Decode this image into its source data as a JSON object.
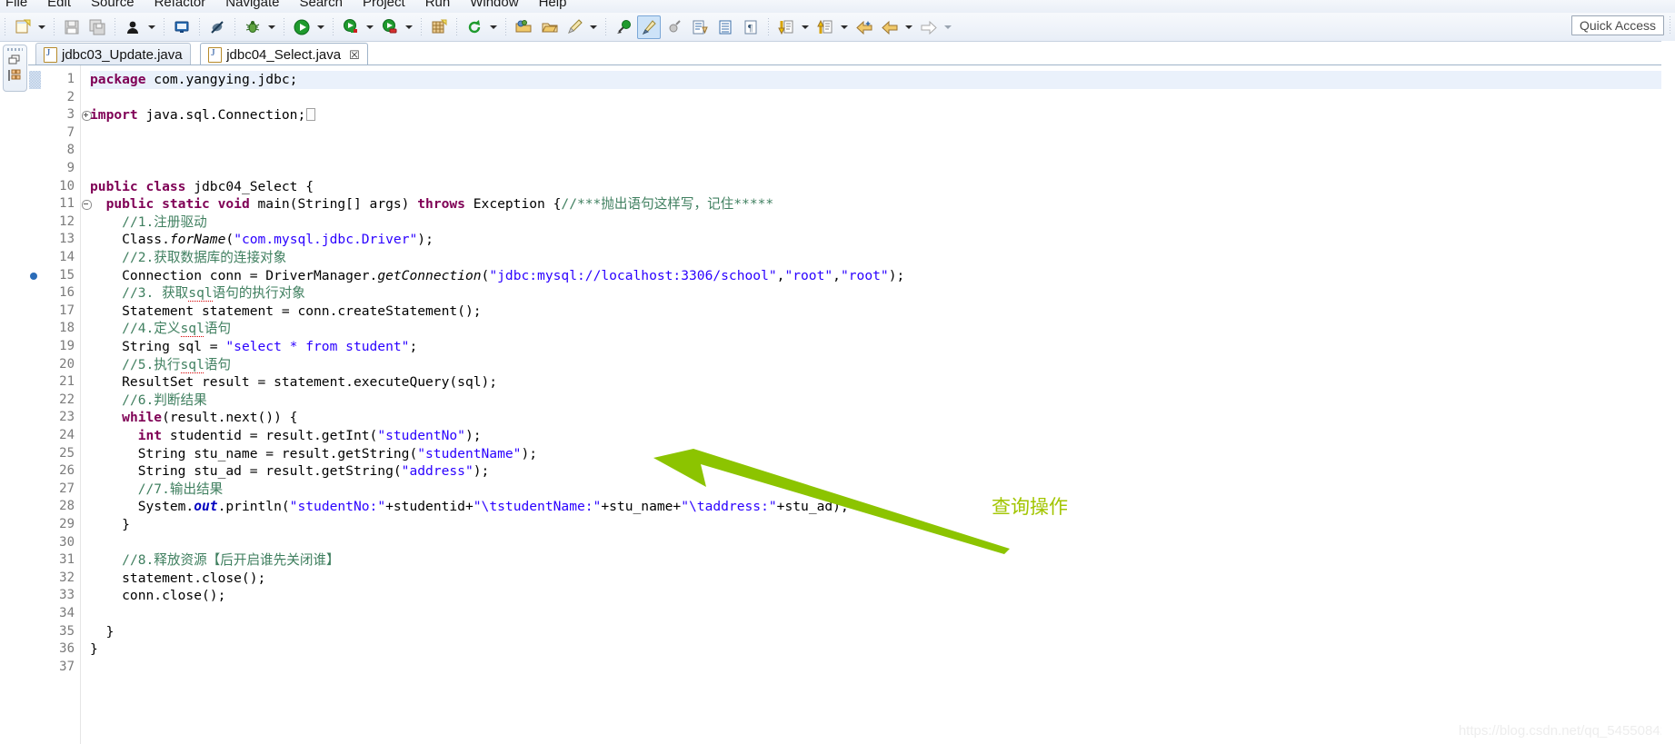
{
  "menubar": {
    "items": [
      "File",
      "Edit",
      "Source",
      "Refactor",
      "Navigate",
      "Search",
      "Project",
      "Run",
      "Window",
      "Help"
    ]
  },
  "toolbar": {
    "quick_access_label": "Quick Access",
    "buttons": [
      {
        "name": "new-wizard",
        "icon": "new-file-icon"
      },
      {
        "name": "save",
        "icon": "save-icon"
      },
      {
        "name": "save-all",
        "icon": "save-all-icon"
      },
      {
        "name": "person",
        "icon": "person-icon"
      },
      {
        "name": "console",
        "icon": "console-icon"
      },
      {
        "name": "skip-breakpoints",
        "icon": "skip-breakpoints-icon"
      },
      {
        "name": "debug",
        "icon": "bug-icon"
      },
      {
        "name": "run",
        "icon": "run-icon"
      },
      {
        "name": "run-as-coverage",
        "icon": "coverage-icon"
      },
      {
        "name": "profile",
        "icon": "profile-icon"
      },
      {
        "name": "new-package",
        "icon": "new-package-icon"
      },
      {
        "name": "refresh",
        "icon": "refresh-icon"
      },
      {
        "name": "open-type",
        "icon": "open-folder-icon"
      },
      {
        "name": "open-resource",
        "icon": "open-resource-icon"
      },
      {
        "name": "edit-pencil",
        "icon": "pencil-icon"
      },
      {
        "name": "search",
        "icon": "search-icon"
      },
      {
        "name": "marker-brush",
        "icon": "brush-icon"
      },
      {
        "name": "toggle-mark",
        "icon": "mark-occurrence-icon"
      },
      {
        "name": "next-annotation",
        "icon": "next-annotation-icon"
      },
      {
        "name": "outline",
        "icon": "outline-icon"
      },
      {
        "name": "paragraph",
        "icon": "pilcrow-icon"
      },
      {
        "name": "next-edit",
        "icon": "next-edit-icon"
      },
      {
        "name": "previous-edit",
        "icon": "previous-edit-icon"
      },
      {
        "name": "back",
        "icon": "back-arrow-icon"
      },
      {
        "name": "forward",
        "icon": "forward-arrow-icon"
      },
      {
        "name": "forward-gray",
        "icon": "forward-gray-arrow-icon"
      }
    ]
  },
  "viewstack": {
    "restore_icon": "restore-icon",
    "items": [
      {
        "name": "package-explorer",
        "icon": "package-explorer-icon"
      }
    ]
  },
  "tabs": [
    {
      "label": "jdbc03_Update.java",
      "active": false,
      "closable": false
    },
    {
      "label": "jdbc04_Select.java",
      "active": true,
      "closable": true,
      "close_glyph": "☒"
    }
  ],
  "editor": {
    "filename": "jdbc04_Select.java",
    "highlighted_line": 1,
    "breakpoint_line": 15,
    "folded_line": 3,
    "collapsible_line": 11,
    "line_numbers": [
      1,
      2,
      3,
      7,
      8,
      9,
      10,
      11,
      12,
      13,
      14,
      15,
      16,
      17,
      18,
      19,
      20,
      21,
      22,
      23,
      24,
      25,
      26,
      27,
      28,
      29,
      30,
      31,
      32,
      33,
      34,
      35,
      36,
      37
    ],
    "lines": [
      {
        "n": 1,
        "segments": [
          {
            "t": "package",
            "c": "kw"
          },
          {
            "t": " com.yangying.jdbc;",
            "c": ""
          }
        ]
      },
      {
        "n": 2,
        "segments": []
      },
      {
        "n": 3,
        "segments": [
          {
            "t": "import",
            "c": "kw"
          },
          {
            "t": " java.sql.Connection;",
            "c": ""
          },
          {
            "t": "□",
            "c": "foldbox"
          }
        ]
      },
      {
        "n": 7,
        "segments": []
      },
      {
        "n": 8,
        "segments": []
      },
      {
        "n": 9,
        "segments": []
      },
      {
        "n": 10,
        "segments": [
          {
            "t": "public class",
            "c": "kw"
          },
          {
            "t": " jdbc04_Select {",
            "c": ""
          }
        ]
      },
      {
        "n": 11,
        "segments": [
          {
            "t": "  ",
            "c": ""
          },
          {
            "t": "public static void",
            "c": "kw"
          },
          {
            "t": " main(String[] args) ",
            "c": ""
          },
          {
            "t": "throws",
            "c": "kw"
          },
          {
            "t": " Exception {",
            "c": ""
          },
          {
            "t": "//***抛出语句这样写，记住*****",
            "c": "cmt"
          }
        ]
      },
      {
        "n": 12,
        "segments": [
          {
            "t": "    ",
            "c": ""
          },
          {
            "t": "//1.注册驱动",
            "c": "cmt"
          }
        ]
      },
      {
        "n": 13,
        "segments": [
          {
            "t": "    Class.",
            "c": ""
          },
          {
            "t": "forName",
            "c": "smeth"
          },
          {
            "t": "(",
            "c": ""
          },
          {
            "t": "\"com.mysql.jdbc.Driver\"",
            "c": "str"
          },
          {
            "t": ");",
            "c": ""
          }
        ]
      },
      {
        "n": 14,
        "segments": [
          {
            "t": "    ",
            "c": ""
          },
          {
            "t": "//2.获取数据库的连接对象",
            "c": "cmt"
          }
        ]
      },
      {
        "n": 15,
        "segments": [
          {
            "t": "    Connection conn = DriverManager.",
            "c": ""
          },
          {
            "t": "getConnection",
            "c": "smeth"
          },
          {
            "t": "(",
            "c": ""
          },
          {
            "t": "\"jdbc:mysql://localhost:3306/school\"",
            "c": "str"
          },
          {
            "t": ",",
            "c": ""
          },
          {
            "t": "\"root\"",
            "c": "str"
          },
          {
            "t": ",",
            "c": ""
          },
          {
            "t": "\"root\"",
            "c": "str"
          },
          {
            "t": ");",
            "c": ""
          }
        ]
      },
      {
        "n": 16,
        "segments": [
          {
            "t": "    ",
            "c": ""
          },
          {
            "t": "//3. 获取",
            "c": "cmt"
          },
          {
            "t": "sql",
            "c": "cmt-spell"
          },
          {
            "t": "语句的执行对象",
            "c": "cmt"
          }
        ]
      },
      {
        "n": 17,
        "segments": [
          {
            "t": "    Statement statement = conn.createStatement();",
            "c": ""
          }
        ]
      },
      {
        "n": 18,
        "segments": [
          {
            "t": "    ",
            "c": ""
          },
          {
            "t": "//4.定义",
            "c": "cmt"
          },
          {
            "t": "sql",
            "c": "cmt-spell"
          },
          {
            "t": "语句",
            "c": "cmt"
          }
        ]
      },
      {
        "n": 19,
        "segments": [
          {
            "t": "    String sql = ",
            "c": ""
          },
          {
            "t": "\"select * from student\"",
            "c": "str"
          },
          {
            "t": ";",
            "c": ""
          }
        ]
      },
      {
        "n": 20,
        "segments": [
          {
            "t": "    ",
            "c": ""
          },
          {
            "t": "//5.执行",
            "c": "cmt"
          },
          {
            "t": "sql",
            "c": "cmt-spell"
          },
          {
            "t": "语句",
            "c": "cmt"
          }
        ]
      },
      {
        "n": 21,
        "segments": [
          {
            "t": "    ResultSet result = statement.executeQuery(sql);",
            "c": ""
          }
        ]
      },
      {
        "n": 22,
        "segments": [
          {
            "t": "    ",
            "c": ""
          },
          {
            "t": "//6.判断结果",
            "c": "cmt"
          }
        ]
      },
      {
        "n": 23,
        "segments": [
          {
            "t": "    ",
            "c": ""
          },
          {
            "t": "while",
            "c": "kw"
          },
          {
            "t": "(result.next()) {",
            "c": ""
          }
        ]
      },
      {
        "n": 24,
        "segments": [
          {
            "t": "      ",
            "c": ""
          },
          {
            "t": "int",
            "c": "kw"
          },
          {
            "t": " studentid = result.getInt(",
            "c": ""
          },
          {
            "t": "\"studentNo\"",
            "c": "str"
          },
          {
            "t": ");",
            "c": ""
          }
        ]
      },
      {
        "n": 25,
        "segments": [
          {
            "t": "      String stu_name = result.getString(",
            "c": ""
          },
          {
            "t": "\"studentName\"",
            "c": "str"
          },
          {
            "t": ");",
            "c": ""
          }
        ]
      },
      {
        "n": 26,
        "segments": [
          {
            "t": "      String stu_ad = result.getString(",
            "c": ""
          },
          {
            "t": "\"address\"",
            "c": "str"
          },
          {
            "t": ");",
            "c": ""
          }
        ]
      },
      {
        "n": 27,
        "segments": [
          {
            "t": "      ",
            "c": ""
          },
          {
            "t": "//7.输出结果",
            "c": "cmt"
          }
        ]
      },
      {
        "n": 28,
        "segments": [
          {
            "t": "      System.",
            "c": ""
          },
          {
            "t": "out",
            "c": "sfield"
          },
          {
            "t": ".println(",
            "c": ""
          },
          {
            "t": "\"studentNo:\"",
            "c": "str"
          },
          {
            "t": "+studentid+",
            "c": ""
          },
          {
            "t": "\"\\tstudentName:\"",
            "c": "str"
          },
          {
            "t": "+stu_name+",
            "c": ""
          },
          {
            "t": "\"\\taddress:\"",
            "c": "str"
          },
          {
            "t": "+stu_ad);",
            "c": ""
          }
        ]
      },
      {
        "n": 29,
        "segments": [
          {
            "t": "    }",
            "c": ""
          }
        ]
      },
      {
        "n": 30,
        "segments": []
      },
      {
        "n": 31,
        "segments": [
          {
            "t": "    ",
            "c": ""
          },
          {
            "t": "//8.释放资源【后开启谁先关闭谁】",
            "c": "cmt"
          }
        ]
      },
      {
        "n": 32,
        "segments": [
          {
            "t": "    statement.close();",
            "c": ""
          }
        ]
      },
      {
        "n": 33,
        "segments": [
          {
            "t": "    conn.close();",
            "c": ""
          }
        ]
      },
      {
        "n": 34,
        "segments": []
      },
      {
        "n": 35,
        "segments": [
          {
            "t": "  }",
            "c": ""
          }
        ]
      },
      {
        "n": 36,
        "segments": [
          {
            "t": "}",
            "c": ""
          }
        ]
      },
      {
        "n": 37,
        "segments": []
      }
    ]
  },
  "annotation": {
    "text": "查询操作",
    "color": "#a2c500",
    "arrow_color": "#8cc400"
  },
  "watermark": {
    "text": "https://blog.csdn.net/qq_54550842"
  },
  "colors": {
    "keyword": "#7f0055",
    "string": "#2a00ff",
    "comment": "#3f7f5f",
    "static_field": "#0000c0",
    "line_number": "#7b7b7b",
    "selection_row": "#eaf1fb"
  }
}
